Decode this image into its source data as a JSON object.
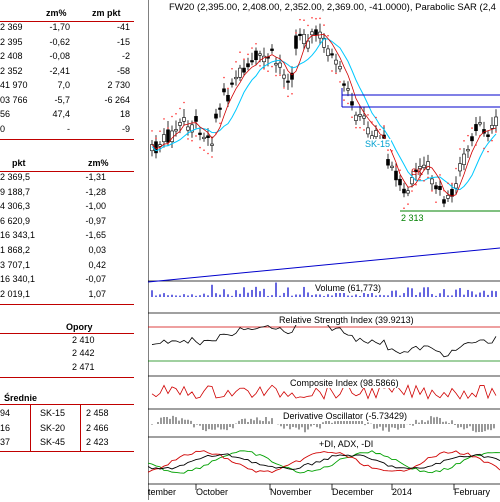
{
  "left": {
    "top_headers": [
      "zm%",
      "zm pkt"
    ],
    "top_rows": [
      {
        "value": "2 369",
        "chg_pct": "-1,70",
        "chg_pkt": "-41"
      },
      {
        "value": "2 395",
        "chg_pct": "-0,62",
        "chg_pkt": "-15"
      },
      {
        "value": "2 408",
        "chg_pct": "-0,08",
        "chg_pkt": "-2"
      },
      {
        "value": "2 352",
        "chg_pct": "-2,41",
        "chg_pkt": "-58"
      },
      {
        "value": "41 970",
        "chg_pct": "7,0",
        "chg_pkt": "2 730"
      },
      {
        "value": "03 766",
        "chg_pct": "-5,7",
        "chg_pkt": "-6 264"
      },
      {
        "value": "56",
        "chg_pct": "47,4",
        "chg_pkt": "18"
      },
      {
        "value": "0",
        "chg_pct": "-",
        "chg_pkt": "-9"
      }
    ],
    "mid_headers": [
      "pkt",
      "zm%"
    ],
    "mid_rows": [
      {
        "pkt": "2 369,5",
        "pct": "-1,31"
      },
      {
        "pkt": "9 188,7",
        "pct": "-1,28"
      },
      {
        "pkt": "4 306,3",
        "pct": "-1,00"
      },
      {
        "pkt": "6 620,9",
        "pct": "-0,97"
      },
      {
        "pkt": "16 343,1",
        "pct": "-1,65"
      },
      {
        "pkt": "1 868,2",
        "pct": "0,03"
      },
      {
        "pkt": "3 707,1",
        "pct": "0,42"
      },
      {
        "pkt": "16 340,1",
        "pct": "-0,07"
      },
      {
        "pkt": "2 019,1",
        "pct": "1,07"
      }
    ],
    "opory": {
      "title": "Opory",
      "values": [
        "2 410",
        "2 442",
        "2 471"
      ]
    },
    "srednie": {
      "title": "Średnie",
      "rows": [
        {
          "a": "94",
          "label": "SK-15",
          "value": "2 458"
        },
        {
          "a": "16",
          "label": "SK-20",
          "value": "2 466"
        },
        {
          "a": "37",
          "label": "SK-45",
          "value": "2 423"
        }
      ]
    }
  },
  "chart": {
    "price_title": "FW20 (2,395.00, 2,408.00, 2,352.00, 2,369.00, -41.0000), Parabolic SAR (2,4",
    "annotations": {
      "sk15": "SK-15",
      "sk": "SK",
      "low_label": "2 313"
    },
    "volume_title": "Volume (61,773)",
    "rsi_title": "Relative Strength Index (39.9213)",
    "composite_title": "Composite Index (98.5866)",
    "deriv_title": "Derivative Oscillator (-5.73429)",
    "adx_title": "+DI, ADX, -DI",
    "months": [
      "tember",
      "October",
      "November",
      "December",
      "2014",
      "February"
    ],
    "colors": {
      "up": "#ffffff",
      "down": "#000000",
      "sma_cyan": "#00c8ff",
      "sma_red": "#d00000",
      "sar": "#ff3030",
      "resist": "#0000cc",
      "support": "#008000",
      "volume": "#0000cc",
      "composite": "#d00000",
      "adx_green": "#00a000",
      "adx_red": "#d00000"
    }
  }
}
